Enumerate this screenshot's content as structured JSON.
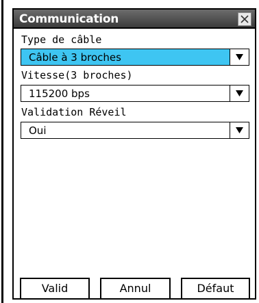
{
  "dialog": {
    "title": "Communication",
    "close_icon": "close-icon"
  },
  "fields": {
    "cable_type": {
      "label": "Type de câble",
      "value": "Câble à 3 broches"
    },
    "speed": {
      "label": "Vitesse(3 broches)",
      "value": "115200 bps"
    },
    "wakeup": {
      "label": "Validation Réveil",
      "value": "Oui"
    }
  },
  "buttons": {
    "ok": "Valid",
    "cancel": "Annul",
    "default": "Défaut"
  },
  "colors": {
    "selected_field": "#3ec5f2",
    "titlebar": "#4a4a4a"
  }
}
